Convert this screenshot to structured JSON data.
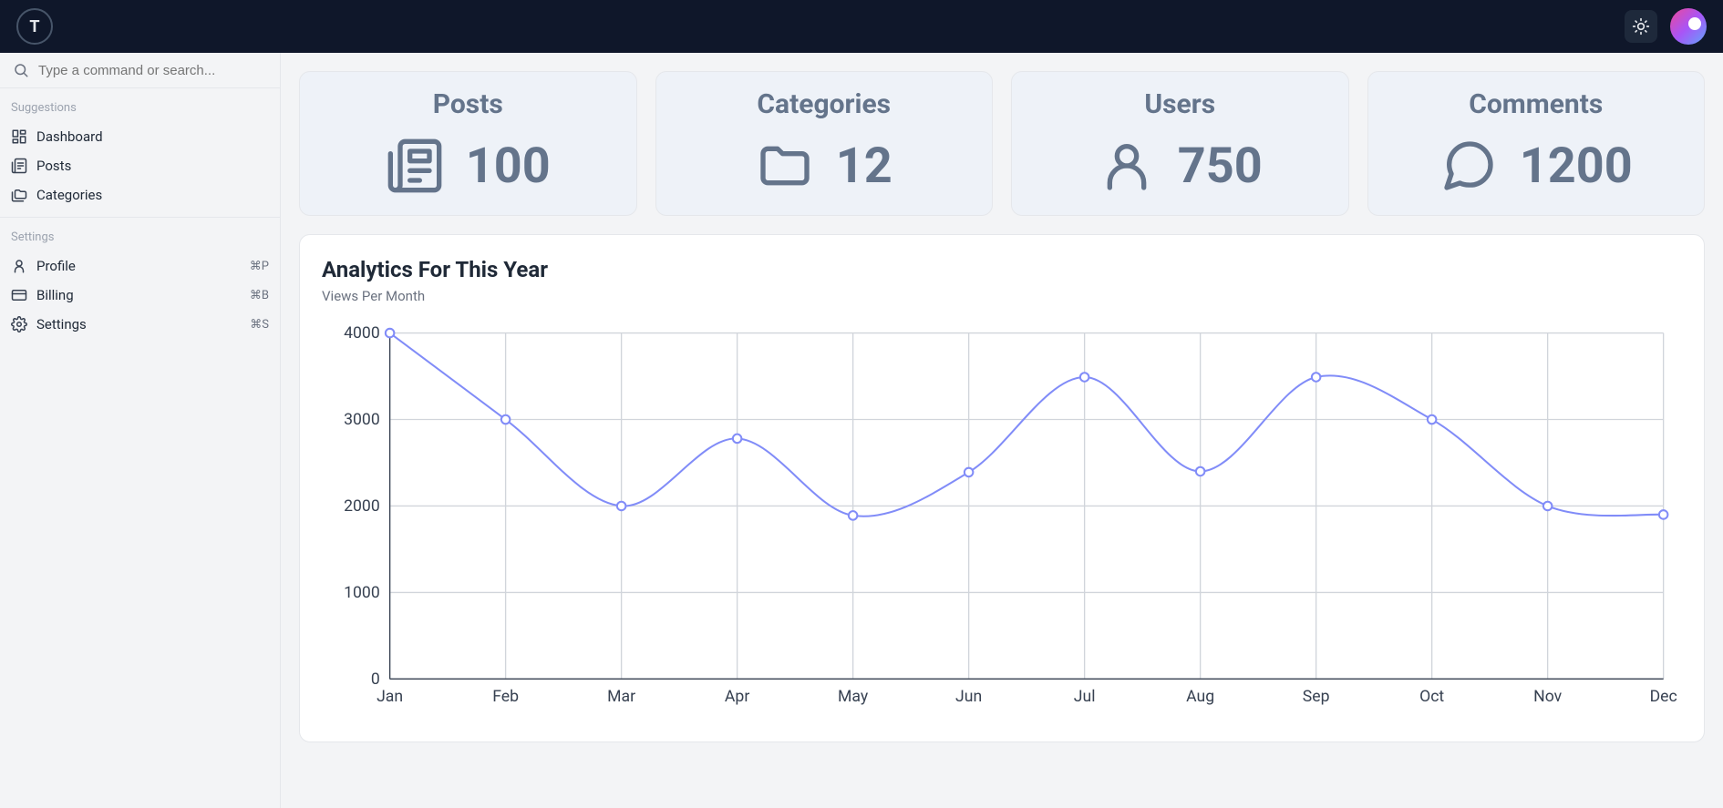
{
  "topbar": {
    "logo_letter": "T"
  },
  "search": {
    "placeholder": "Type a command or search..."
  },
  "sidebar": {
    "sections": [
      {
        "label": "Suggestions",
        "items": [
          {
            "label": "Dashboard",
            "icon": "dashboard-icon"
          },
          {
            "label": "Posts",
            "icon": "newspaper-icon"
          },
          {
            "label": "Categories",
            "icon": "folders-icon"
          }
        ]
      },
      {
        "label": "Settings",
        "items": [
          {
            "label": "Profile",
            "icon": "user-icon",
            "shortcut": "⌘P"
          },
          {
            "label": "Billing",
            "icon": "credit-card-icon",
            "shortcut": "⌘B"
          },
          {
            "label": "Settings",
            "icon": "gear-icon",
            "shortcut": "⌘S"
          }
        ]
      }
    ]
  },
  "stats": [
    {
      "title": "Posts",
      "value": "100",
      "icon": "newspaper"
    },
    {
      "title": "Categories",
      "value": "12",
      "icon": "folder"
    },
    {
      "title": "Users",
      "value": "750",
      "icon": "user"
    },
    {
      "title": "Comments",
      "value": "1200",
      "icon": "comment"
    }
  ],
  "chart": {
    "title": "Analytics For This Year",
    "subtitle": "Views Per Month"
  },
  "chart_data": {
    "type": "line",
    "title": "Analytics For This Year",
    "subtitle": "Views Per Month",
    "xlabel": "",
    "ylabel": "",
    "ylim": [
      0,
      4000
    ],
    "categories": [
      "Jan",
      "Feb",
      "Mar",
      "Apr",
      "May",
      "Jun",
      "Jul",
      "Aug",
      "Sep",
      "Oct",
      "Nov",
      "Dec"
    ],
    "values": [
      4100,
      3000,
      2000,
      2780,
      1890,
      2390,
      3490,
      2400,
      3490,
      3000,
      2000,
      1900
    ],
    "y_ticks": [
      0,
      1000,
      2000,
      3000,
      4000
    ]
  }
}
